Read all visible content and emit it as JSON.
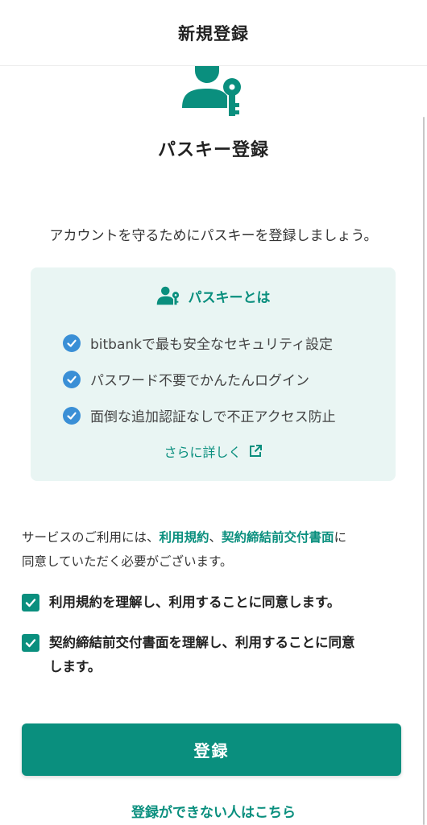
{
  "header": {
    "title": "新規登録"
  },
  "icons": {
    "hero": "user-key-icon",
    "info": "user-key-icon",
    "check": "check-circle-icon",
    "external": "external-link-icon",
    "checkbox": "checkbox-checked-icon"
  },
  "colors": {
    "accent": "#0a8f7e",
    "info_bg": "#e9f5f3",
    "check_blue": "#3a8fd6"
  },
  "main": {
    "heading": "パスキー登録",
    "intro": "アカウントを守るためにパスキーを登録しましょう。"
  },
  "info_box": {
    "title": "パスキーとは",
    "features": [
      "bitbankで最も安全なセキュリティ設定",
      "パスワード不要でかんたんログイン",
      "面倒な追加認証なしで不正アクセス防止"
    ],
    "more_link": "さらに詳しく"
  },
  "terms": {
    "prefix": "サービスのご利用には、",
    "link1": "利用規約",
    "sep": "、",
    "link2": "契約締結前交付書面",
    "suffix1": "に",
    "suffix2": "同意していただく必要がございます。"
  },
  "agreements": [
    {
      "line1": "利用規約を理解し、利用することに同意します。",
      "line2": "",
      "checked": true
    },
    {
      "line1": "契約締結前交付書面を理解し、利用することに同意",
      "line2": "します。",
      "checked": true
    }
  ],
  "actions": {
    "register_label": "登録",
    "help_link": "登録ができない人はこちら"
  }
}
